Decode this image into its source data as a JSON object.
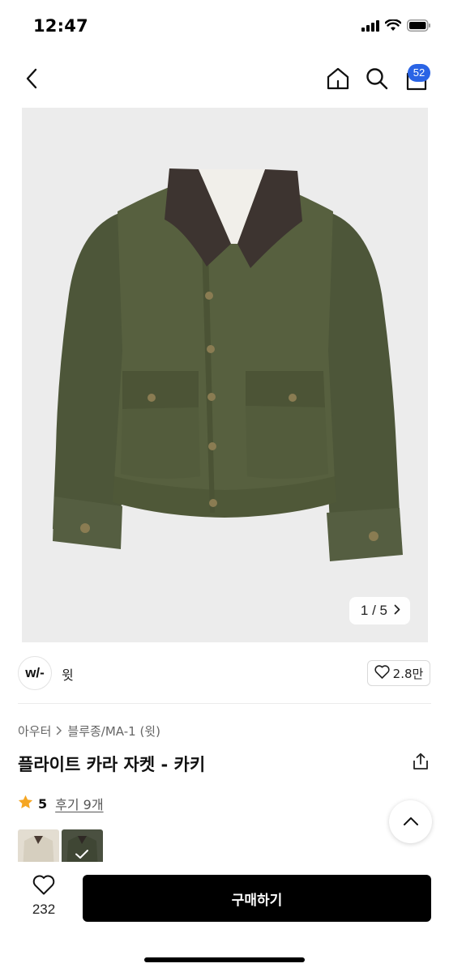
{
  "status_bar": {
    "time": "12:47"
  },
  "nav": {
    "icons": [
      "chevron-left-icon",
      "home-icon",
      "search-icon",
      "shopping-bag-icon"
    ],
    "cart_badge": "52"
  },
  "gallery": {
    "counter": "1 / 5",
    "colors": {
      "jacket": "#525a40",
      "collar": "#3d3430",
      "background": "#ececec"
    }
  },
  "brand": {
    "logo_text": "w/-",
    "name": "윗",
    "like_count": "2.8만"
  },
  "breadcrumb": {
    "category": "아우터",
    "subcategory": "블루종/MA-1 (윗)"
  },
  "product": {
    "title": "플라이트 카라 자켓 - 카키"
  },
  "rating": {
    "score": "5",
    "review_text": "후기 9개",
    "star_color": "#f5a623"
  },
  "bottom_bar": {
    "wish_count": "232",
    "buy_label": "구매하기"
  },
  "colors": {
    "accent": "#2a64e5",
    "primary_button": "#000000"
  }
}
